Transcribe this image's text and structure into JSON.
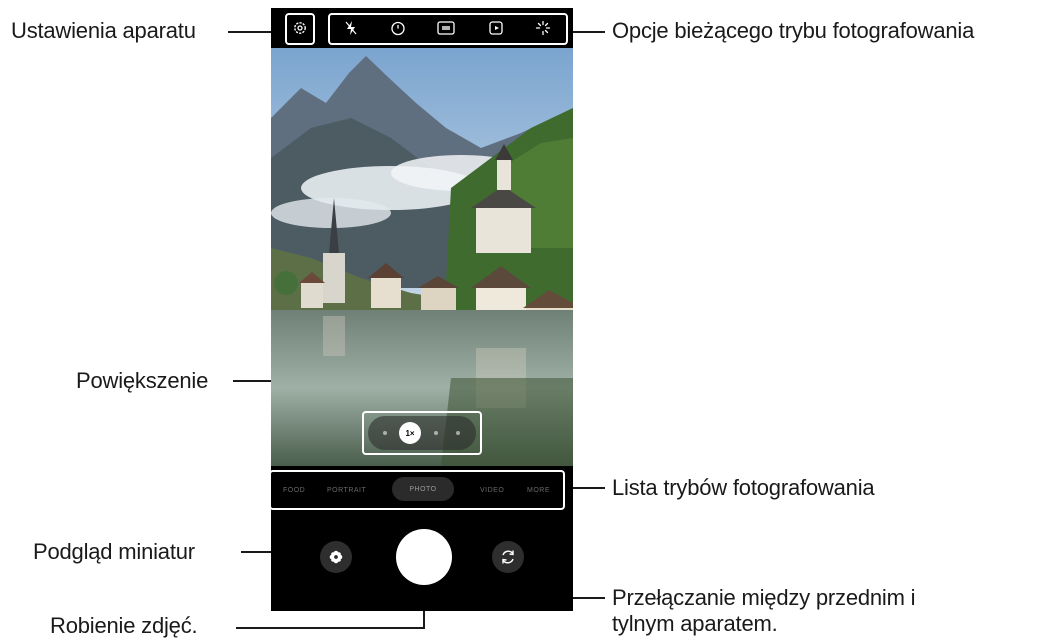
{
  "callouts": {
    "camera_settings": "Ustawienia aparatu",
    "current_mode_options": "Opcje bieżącego trybu fotografowania",
    "zoom": "Powiększenie",
    "shooting_modes_list": "Lista trybów fotografowania",
    "thumbnail_preview": "Podgląd miniatur",
    "take_pictures": "Robienie zdjęć.",
    "switch_cameras_line1": "Przełączanie między przednim i",
    "switch_cameras_line2": "tylnym aparatem."
  },
  "camera": {
    "zoom_active": "1×",
    "modes": [
      "FOOD",
      "PORTRAIT",
      "PHOTO",
      "VIDEO",
      "MORE"
    ],
    "active_mode": "PHOTO"
  },
  "colors": {
    "background": "#ffffff",
    "text": "#1a1a1a",
    "phone_bg": "#000000",
    "shutter": "#ffffff"
  }
}
